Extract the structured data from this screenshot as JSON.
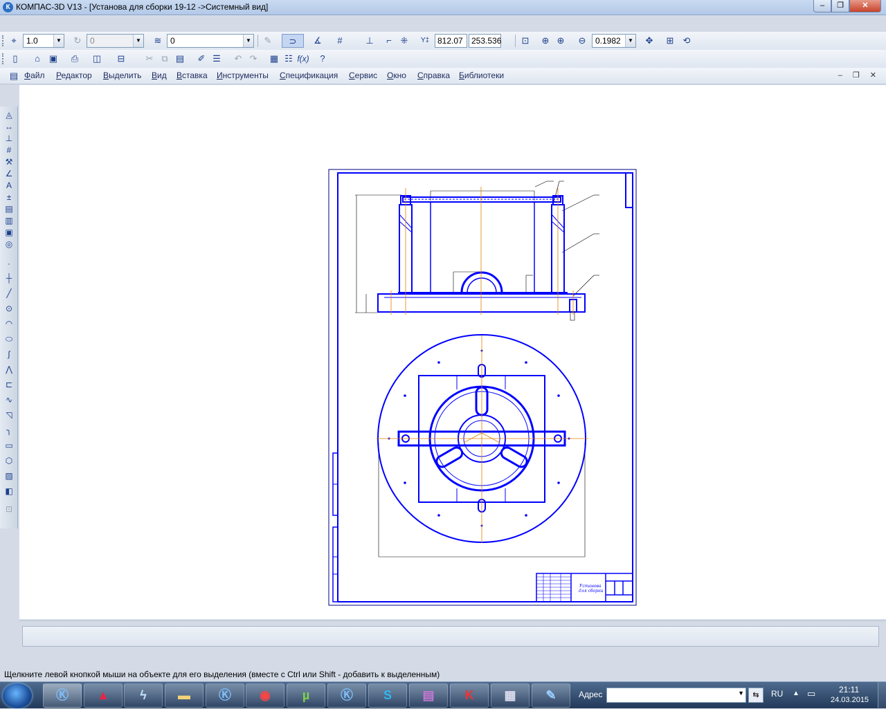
{
  "window": {
    "title": "КОМПАС-3D V13 - [Установа для  сборки 19-12 ->Системный вид]",
    "minimize": "‒",
    "maximize": "❐",
    "close": "✕",
    "app_icon": "К"
  },
  "toolbar1": {
    "step_value": "1.0",
    "angle_value": "0",
    "layer_value": "0",
    "coord_x": "812.07",
    "coord_y": "253.536",
    "zoom_value": "0.1982"
  },
  "menu": {
    "items": [
      "Файл",
      "Редактор",
      "Выделить",
      "Вид",
      "Вставка",
      "Инструменты",
      "Спецификация",
      "Сервис",
      "Окно",
      "Справка",
      "Библиотеки"
    ],
    "doc_controls": "– ❐ ✕"
  },
  "drawing": {
    "title_block_name_line1": "Установа",
    "title_block_name_line2": "для сборки",
    "colors": {
      "line": "#0000ff",
      "axis": "#e08000",
      "frame": "#000080"
    }
  },
  "status": {
    "hint": "Щелкните левой кнопкой мыши на объекте для его выделения (вместе с Ctrl или Shift - добавить к выделенным)"
  },
  "taskbar": {
    "address_label": "Адрес",
    "language": "RU",
    "time": "21:11",
    "date": "24.03.2015",
    "apps": [
      "kompas-icon",
      "autocad-icon",
      "bolt-icon",
      "folder-icon",
      "kompas-icon",
      "chrome-icon",
      "utorrent-icon",
      "kompas-icon",
      "skype-icon",
      "winrar-icon",
      "kompas-viewer-icon",
      "calculator-icon",
      "paint-icon"
    ]
  }
}
